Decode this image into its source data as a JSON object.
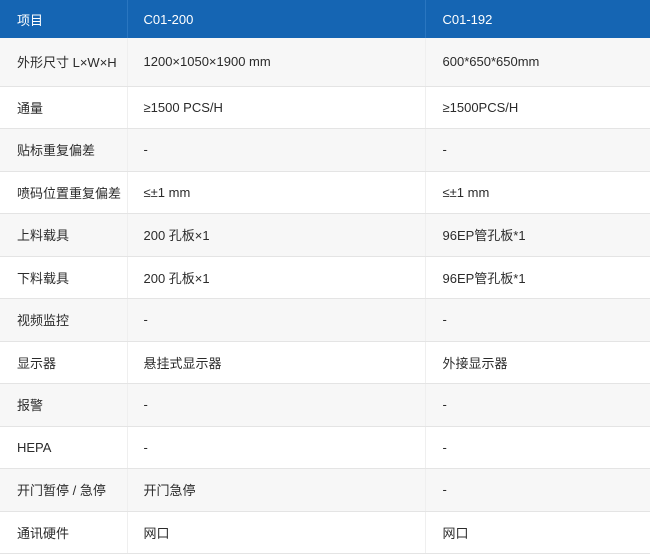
{
  "header": {
    "col1": "项目",
    "col2": "C01-200",
    "col3": "C01-192"
  },
  "rows": [
    {
      "label": "外形尺寸 L×W×H",
      "c01_200": "1200×1050×1900 mm",
      "c01_192": "600*650*650mm"
    },
    {
      "label": "通量",
      "c01_200": "≥1500 PCS/H",
      "c01_192": "≥1500PCS/H"
    },
    {
      "label": "贴标重复偏差",
      "c01_200": "-",
      "c01_192": "-"
    },
    {
      "label": "喷码位置重复偏差",
      "c01_200": "≤±1 mm",
      "c01_192": "≤±1 mm"
    },
    {
      "label": "上料载具",
      "c01_200": "200 孔板×1",
      "c01_192": "96EP管孔板*1"
    },
    {
      "label": "下料载具",
      "c01_200": "200 孔板×1",
      "c01_192": "96EP管孔板*1"
    },
    {
      "label": "视频监控",
      "c01_200": "-",
      "c01_192": "-"
    },
    {
      "label": "显示器",
      "c01_200": "悬挂式显示器",
      "c01_192": "外接显示器"
    },
    {
      "label": "报警",
      "c01_200": "-",
      "c01_192": "-"
    },
    {
      "label": "HEPA",
      "c01_200": "-",
      "c01_192": "-"
    },
    {
      "label": "开门暂停 / 急停",
      "c01_200": "开门急停",
      "c01_192": "-"
    },
    {
      "label": "通讯硬件",
      "c01_200": "网口",
      "c01_192": "网口"
    }
  ],
  "colors": {
    "header_bg": "#1565b3",
    "header_text": "#ffffff",
    "row_alt_bg": "#f7f7f7",
    "border": "#e4e4e4"
  }
}
